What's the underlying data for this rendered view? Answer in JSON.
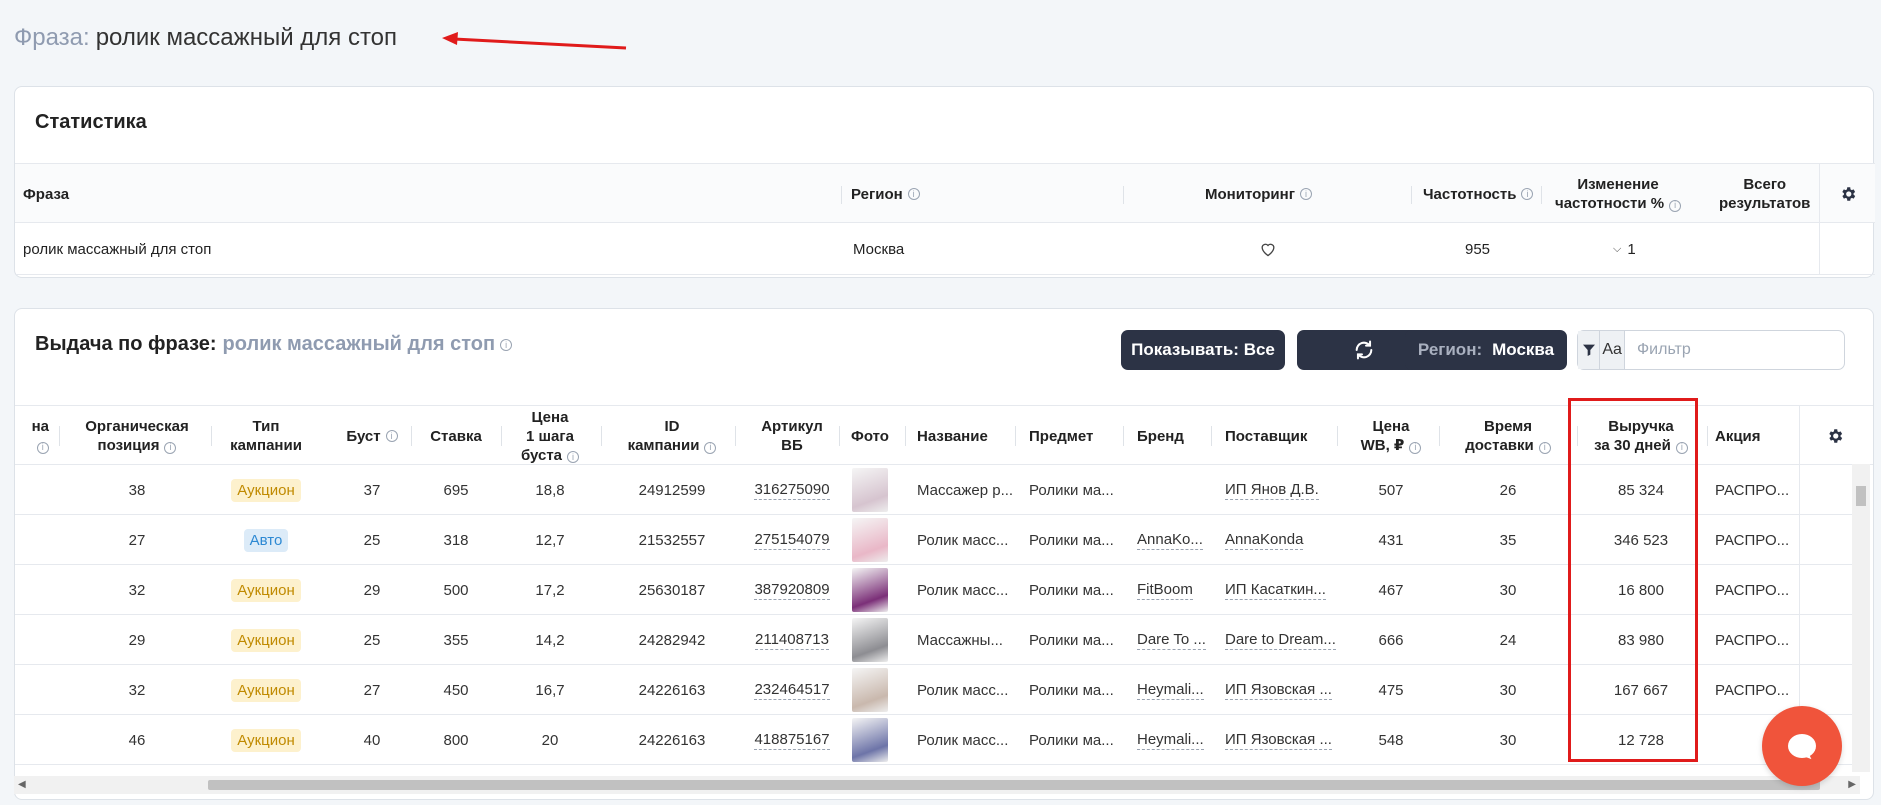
{
  "phrase_header": {
    "label": "Фраза:",
    "value": "ролик массажный для стоп"
  },
  "stats": {
    "title": "Статистика",
    "columns": {
      "phrase": "Фраза",
      "region": "Регион",
      "monitoring": "Мониторинг",
      "frequency": "Частотность",
      "freq_change_1": "Изменение",
      "freq_change_2": "частотности %",
      "total_1": "Всего",
      "total_2": "результатов"
    },
    "row": {
      "phrase": "ролик массажный для стоп",
      "region": "Москва",
      "frequency": "955",
      "freq_change": "1"
    }
  },
  "results": {
    "title": "Выдача по фразе:",
    "phrase": "ролик массажный для стоп",
    "show_button": "Показывать: Все",
    "region_label": "Регион:",
    "region_value": "Москва",
    "aa_label": "Aa",
    "filter_placeholder": "Фильтр",
    "columns": {
      "col0": "на",
      "organic_1": "Органическая",
      "organic_2": "позиция",
      "type_1": "Тип",
      "type_2": "кампании",
      "boost": "Буст",
      "bid": "Ставка",
      "step_1": "Цена",
      "step_2": "1 шага",
      "step_3": "буста",
      "id_1": "ID",
      "id_2": "кампании",
      "article_1": "Артикул",
      "article_2": "ВБ",
      "photo": "Фото",
      "name": "Название",
      "subject": "Предмет",
      "brand": "Бренд",
      "supplier": "Поставщик",
      "price_1": "Цена",
      "price_2": "WB, ₽",
      "delivery_1": "Время",
      "delivery_2": "доставки",
      "revenue_1": "Выручка",
      "revenue_2": "за 30 дней",
      "promo": "Акция"
    },
    "rows": [
      {
        "organic": "38",
        "type": "Аукцион",
        "boost": "37",
        "bid": "695",
        "step": "18,8",
        "campaign_id": "24912599",
        "article": "316275090",
        "name": "Массажер р...",
        "subject": "Ролики ма...",
        "brand": "",
        "supplier": "ИП Янов Д.В.",
        "price": "507",
        "delivery": "26",
        "revenue": "85 324",
        "promo": "РАСПРО..."
      },
      {
        "organic": "27",
        "type": "Авто",
        "boost": "25",
        "bid": "318",
        "step": "12,7",
        "campaign_id": "21532557",
        "article": "275154079",
        "name": "Ролик масс...",
        "subject": "Ролики ма...",
        "brand": "AnnaKo...",
        "supplier": "AnnaKonda",
        "price": "431",
        "delivery": "35",
        "revenue": "346 523",
        "promo": "РАСПРО..."
      },
      {
        "organic": "32",
        "type": "Аукцион",
        "boost": "29",
        "bid": "500",
        "step": "17,2",
        "campaign_id": "25630187",
        "article": "387920809",
        "name": "Ролик масс...",
        "subject": "Ролики ма...",
        "brand": "FitBoom",
        "supplier": "ИП Касаткин...",
        "price": "467",
        "delivery": "30",
        "revenue": "16 800",
        "promo": "РАСПРО..."
      },
      {
        "organic": "29",
        "type": "Аукцион",
        "boost": "25",
        "bid": "355",
        "step": "14,2",
        "campaign_id": "24282942",
        "article": "211408713",
        "name": "Массажны...",
        "subject": "Ролики ма...",
        "brand": "Dare To ...",
        "supplier": "Dare to Dream...",
        "price": "666",
        "delivery": "24",
        "revenue": "83 980",
        "promo": "РАСПРО..."
      },
      {
        "organic": "32",
        "type": "Аукцион",
        "boost": "27",
        "bid": "450",
        "step": "16,7",
        "campaign_id": "24226163",
        "article": "232464517",
        "name": "Ролик масс...",
        "subject": "Ролики ма...",
        "brand": "Heymali...",
        "supplier": "ИП Язовская ...",
        "price": "475",
        "delivery": "30",
        "revenue": "167 667",
        "promo": "РАСПРО..."
      },
      {
        "organic": "46",
        "type": "Аукцион",
        "boost": "40",
        "bid": "800",
        "step": "20",
        "campaign_id": "24226163",
        "article": "418875167",
        "name": "Ролик масс...",
        "subject": "Ролики ма...",
        "brand": "Heymali...",
        "supplier": "ИП Язовская ...",
        "price": "548",
        "delivery": "30",
        "revenue": "12 728",
        "promo": ""
      }
    ]
  },
  "colors": {
    "accent_dark": "#2c3345",
    "auction_bg": "#fdf1cd",
    "auction_fg": "#c08a00",
    "auto_bg": "#dcebf8",
    "auto_fg": "#2d89d3",
    "annotation_red": "#e01b1b",
    "chat_orange": "#f0543b"
  },
  "icons": {
    "heart": "heart-icon",
    "chevron": "chevron-down-icon",
    "refresh": "refresh-icon",
    "filter": "filter-icon",
    "gear": "gear-icon",
    "chat": "chat-icon",
    "info": "info-icon"
  }
}
